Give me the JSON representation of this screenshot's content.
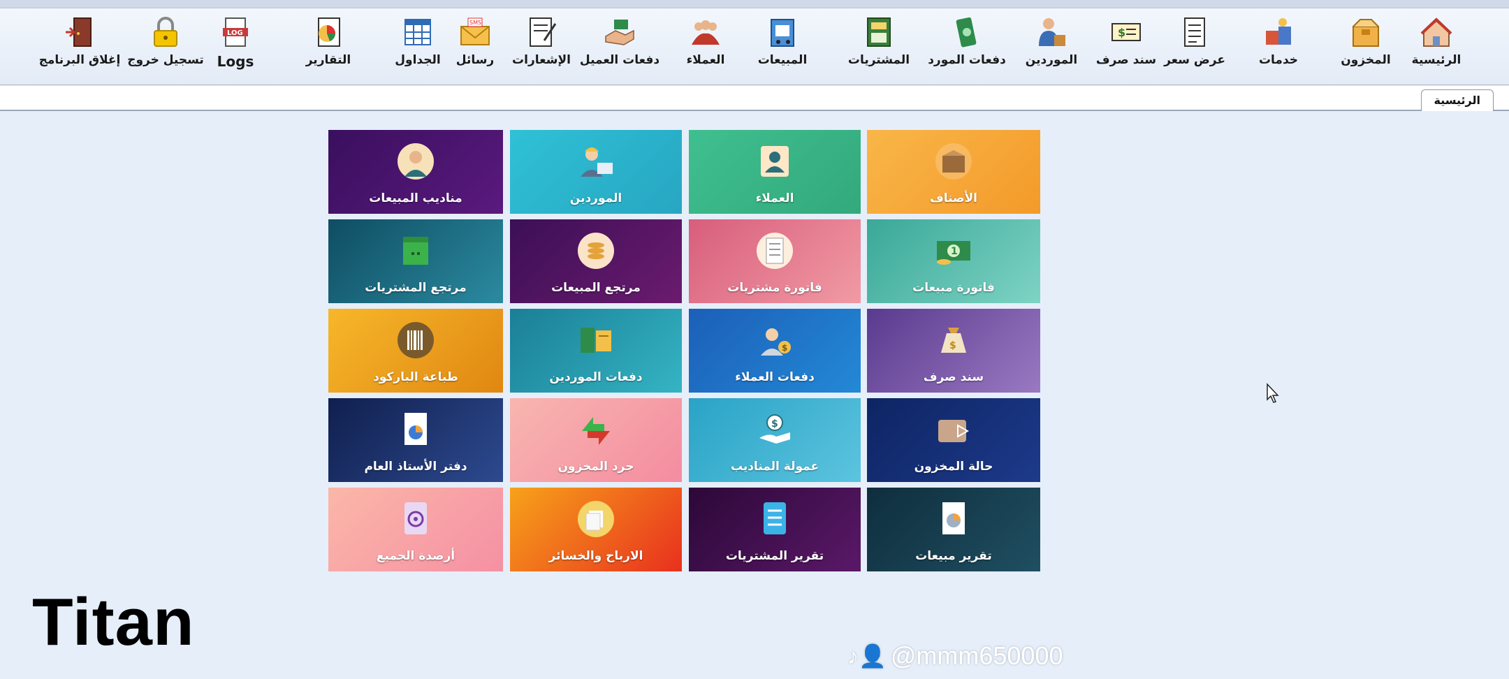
{
  "toolbar": {
    "items": [
      {
        "label": "الرئيسية",
        "icon": "home-icon"
      },
      {
        "label": "المخزون",
        "icon": "warehouse-box-icon"
      },
      {
        "label": "خدمات",
        "icon": "services-icon"
      },
      {
        "label": "عرض سعر",
        "icon": "price-quote-icon"
      },
      {
        "label": "سند صرف",
        "icon": "payment-voucher-icon"
      },
      {
        "label": "الموردين",
        "icon": "suppliers-icon"
      },
      {
        "label": "دفعات المورد",
        "icon": "supplier-payments-icon"
      },
      {
        "label": "المشتريات",
        "icon": "purchases-icon"
      },
      {
        "label": "المبيعات",
        "icon": "sales-icon"
      },
      {
        "label": "العملاء",
        "icon": "customers-icon"
      },
      {
        "label": "دفعات العميل",
        "icon": "customer-payments-icon"
      },
      {
        "label": "الإشعارات",
        "icon": "notifications-icon"
      },
      {
        "label": "رسائل",
        "icon": "sms-icon",
        "badge": "SMS"
      },
      {
        "label": "الجداول",
        "icon": "tables-icon"
      },
      {
        "label": "التقارير",
        "icon": "reports-icon"
      },
      {
        "label": "Logs",
        "icon": "logs-icon",
        "badge": "LOG"
      },
      {
        "label": "تسجيل خروج",
        "icon": "lock-icon"
      },
      {
        "label": "إغلاق البرنامج",
        "icon": "exit-door-icon"
      }
    ]
  },
  "tabs": [
    {
      "label": "الرئيسية"
    }
  ],
  "tiles": [
    {
      "label": "الأصناف",
      "icon": "items-box-icon",
      "bg": "#f7a738"
    },
    {
      "label": "العملاء",
      "icon": "customer-card-icon",
      "bg": "#3fb98c"
    },
    {
      "label": "الموردين",
      "icon": "supplier-worker-icon",
      "bg": "#23b7d0"
    },
    {
      "label": "مناديب المبيعات",
      "icon": "sales-rep-icon",
      "bg": "#4a1772"
    },
    {
      "label": "فاتورة مبيعات",
      "icon": "sales-invoice-icon",
      "bg": "#4cb9a8"
    },
    {
      "label": "فاتورة مشتريات",
      "icon": "purchase-invoice-icon",
      "bg": "#e26d86"
    },
    {
      "label": "مرتجع المبيعات",
      "icon": "sales-return-icon",
      "bg": "#4a1360"
    },
    {
      "label": "مرتجع المشتريات",
      "icon": "purchase-return-icon",
      "bg": "#1f6f85"
    },
    {
      "label": "سند صرف",
      "icon": "money-bag-icon",
      "bg": "#7a5aa6"
    },
    {
      "label": "دفعات العملاء",
      "icon": "customer-payment-icon",
      "bg": "#1e66c0"
    },
    {
      "label": "دفعات الموردين",
      "icon": "supplier-payment-icon",
      "bg": "#2393a8"
    },
    {
      "label": "طباعة الباركود",
      "icon": "barcode-icon",
      "bg": "#f3a51f"
    },
    {
      "label": "حالة المخزون",
      "icon": "stock-status-icon",
      "bg": "#14307a"
    },
    {
      "label": "عمولة المناديب",
      "icon": "commission-hand-icon",
      "bg": "#2fa6c8"
    },
    {
      "label": "جرد المخزون",
      "icon": "inventory-arrows-icon",
      "bg": "#f59aa6"
    },
    {
      "label": "دفتر الأستاذ العام",
      "icon": "ledger-pie-icon",
      "bg": "#1a2f6a"
    },
    {
      "label": "تقرير مبيعات",
      "icon": "sales-report-icon",
      "bg": "#163a4a"
    },
    {
      "label": "تقرير المشتريات",
      "icon": "purchase-report-icon",
      "bg": "#3e0f4e"
    },
    {
      "label": "الارباح والخسائر",
      "icon": "profit-loss-icon",
      "bg": "#f0561e"
    },
    {
      "label": "أرصدة الجميع",
      "icon": "balances-icon",
      "bg": "#f6a3ad"
    }
  ],
  "watermark": {
    "brand": "Titan",
    "handle": "@mmm650000"
  }
}
